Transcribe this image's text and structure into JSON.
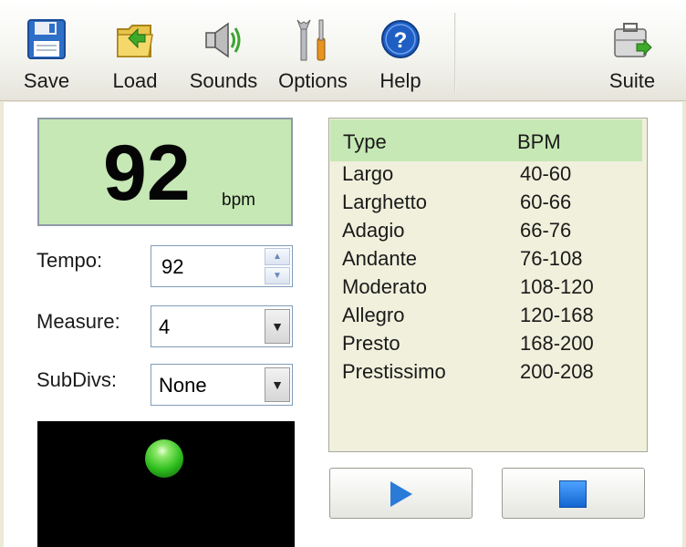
{
  "toolbar": {
    "buttons": [
      {
        "label": "Save",
        "icon": "floppy-disk-icon"
      },
      {
        "label": "Load",
        "icon": "folder-icon"
      },
      {
        "label": "Sounds",
        "icon": "speaker-icon"
      },
      {
        "label": "Options",
        "icon": "tools-icon"
      },
      {
        "label": "Help",
        "icon": "help-icon"
      },
      {
        "label": "Suite",
        "icon": "suite-briefcase-icon"
      }
    ]
  },
  "display": {
    "bpm": "92",
    "unit": "bpm",
    "background": "#c6e8b4"
  },
  "controls": {
    "tempo_label": "Tempo:",
    "tempo_value": "92",
    "measure_label": "Measure:",
    "measure_value": "4",
    "subdivs_label": "SubDivs:",
    "subdivs_value": "None"
  },
  "tempo_table": {
    "headers": [
      "Type",
      "BPM"
    ],
    "rows": [
      {
        "type": "Largo",
        "bpm": "40-60"
      },
      {
        "type": "Larghetto",
        "bpm": "60-66"
      },
      {
        "type": "Adagio",
        "bpm": "66-76"
      },
      {
        "type": "Andante",
        "bpm": "76-108"
      },
      {
        "type": "Moderato",
        "bpm": "108-120"
      },
      {
        "type": "Allegro",
        "bpm": "120-168"
      },
      {
        "type": "Presto",
        "bpm": "168-200"
      },
      {
        "type": "Prestissimo",
        "bpm": "200-208"
      }
    ]
  },
  "playback": {
    "play_icon": "play-icon",
    "stop_icon": "stop-icon"
  },
  "beat_indicator": {
    "led_color": "#2fbf1e"
  }
}
